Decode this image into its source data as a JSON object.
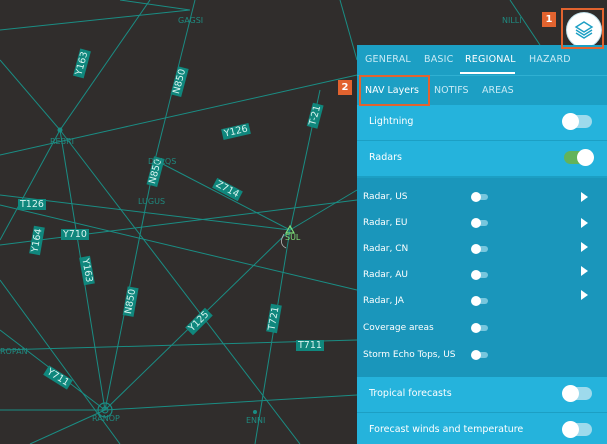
{
  "map": {
    "airways": [
      "Y163",
      "N850",
      "Y126",
      "T-21",
      "N850",
      "Z714",
      "T126",
      "Y164",
      "Y710",
      "Y163",
      "N850",
      "Y125",
      "T721",
      "T711",
      "Y711"
    ],
    "waypoints": [
      "GAGSI",
      "NILLI",
      "REBRI",
      "DOLQS",
      "LUGUS",
      "SUL",
      "ROPAN",
      "RANOP",
      "ENNI"
    ]
  },
  "tabs_top": [
    "GENERAL",
    "BASIC",
    "REGIONAL",
    "HAZARD"
  ],
  "tabs_sub": [
    "NAV Layers",
    "NOTIFS",
    "AREAS"
  ],
  "rows_top": [
    {
      "label": "Lightning",
      "on": false
    },
    {
      "label": "Radars",
      "on": true
    }
  ],
  "sub_rows": [
    {
      "label": "Radar, US",
      "play": true
    },
    {
      "label": "Radar, EU",
      "play": true
    },
    {
      "label": "Radar, CN",
      "play": true
    },
    {
      "label": "Radar, AU",
      "play": true
    },
    {
      "label": "Radar, JA",
      "play": true
    },
    {
      "label": "Coverage areas",
      "play": false
    },
    {
      "label": "Storm Echo Tops, US",
      "play": false
    }
  ],
  "rows_bottom": [
    {
      "label": "Tropical forecasts",
      "on": false
    },
    {
      "label": "Forecast winds and temperature",
      "on": false
    }
  ],
  "annotations": [
    "1",
    "2"
  ],
  "colors": {
    "panel": "#1c9fc4",
    "row": "#25b3dc",
    "map_bg": "#302d2c",
    "line": "#1a8d84",
    "highlight": "#e2632f",
    "toggle_on": "#63b35a"
  },
  "icons": {
    "layers_button": "layers-icon",
    "waypoint": "triangle-icon",
    "vor": "compass-rose-icon"
  }
}
